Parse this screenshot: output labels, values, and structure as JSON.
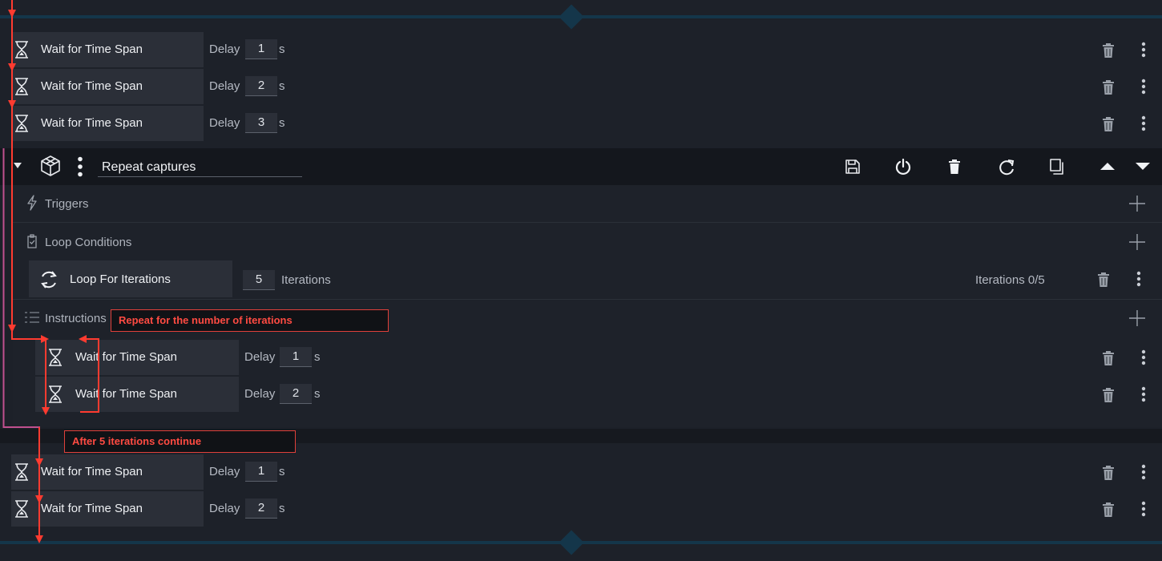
{
  "top_actions": [
    {
      "name": "Wait for Time Span",
      "delay_label": "Delay",
      "value": "1",
      "unit": "s"
    },
    {
      "name": "Wait for Time Span",
      "delay_label": "Delay",
      "value": "2",
      "unit": "s"
    },
    {
      "name": "Wait for Time Span",
      "delay_label": "Delay",
      "value": "3",
      "unit": "s"
    }
  ],
  "group": {
    "title": "Repeat captures",
    "toolbar_icons": [
      "save-icon",
      "power-icon",
      "trash-icon",
      "redo-icon",
      "duplicate-icon",
      "move-up-icon",
      "move-down-icon"
    ],
    "triggers_label": "Triggers",
    "loop_conditions_label": "Loop Conditions",
    "loop": {
      "name": "Loop For Iterations",
      "value": "5",
      "unit": "Iterations",
      "status": "Iterations 0/5"
    },
    "instructions_label": "Instructions",
    "instructions": [
      {
        "name": "Wait for Time Span",
        "delay_label": "Delay",
        "value": "1",
        "unit": "s"
      },
      {
        "name": "Wait for Time Span",
        "delay_label": "Delay",
        "value": "2",
        "unit": "s"
      }
    ]
  },
  "bottom_actions": [
    {
      "name": "Wait for Time Span",
      "delay_label": "Delay",
      "value": "1",
      "unit": "s"
    },
    {
      "name": "Wait for Time Span",
      "delay_label": "Delay",
      "value": "2",
      "unit": "s"
    }
  ],
  "annotations": {
    "repeat": "Repeat for the number of iterations",
    "after": "After 5 iterations continue"
  },
  "colors": {
    "background": "#1d2129",
    "row": "#2b2f38",
    "header": "#14171d",
    "rail": "#14364a",
    "annotation": "#ff4b42",
    "group_marker": "#c0508e"
  }
}
